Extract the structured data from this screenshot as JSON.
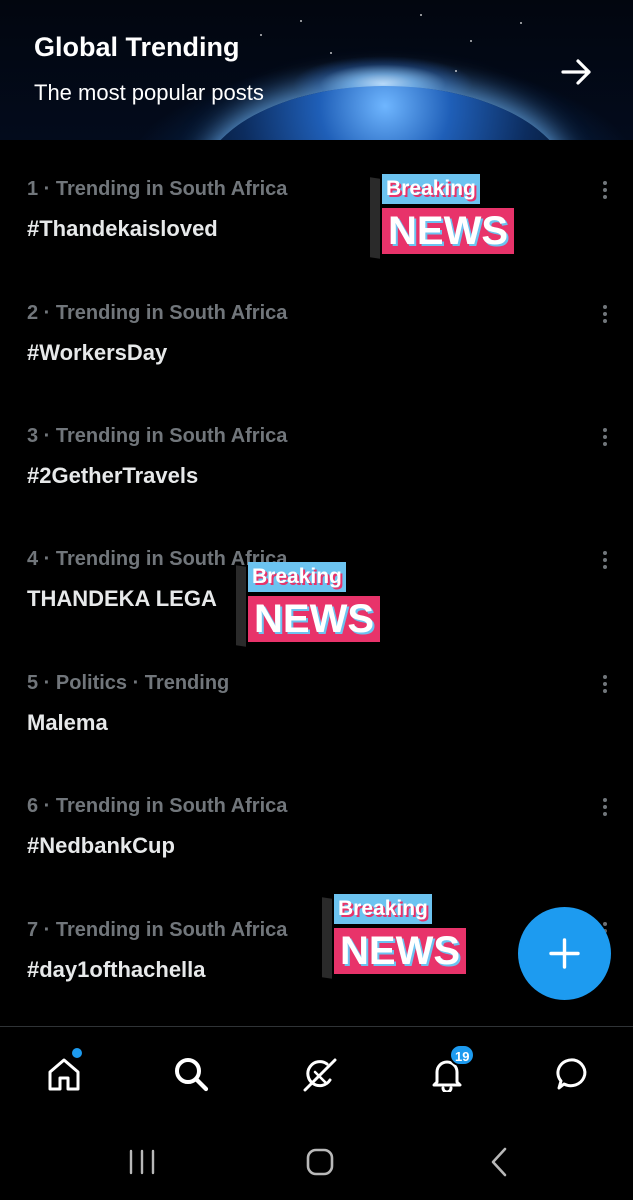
{
  "banner": {
    "title": "Global Trending",
    "subtitle": "The most popular posts",
    "arrow_icon": "arrow-right-icon"
  },
  "trends": [
    {
      "meta": "1 · Trending in South Africa",
      "name": "#Thandekaisloved"
    },
    {
      "meta": "2 · Trending in South Africa",
      "name": "#WorkersDay"
    },
    {
      "meta": "3 · Trending in South Africa",
      "name": "#2GetherTravels"
    },
    {
      "meta": "4 · Trending in South Africa",
      "name": "THANDEKA LEGA"
    },
    {
      "meta": "5 · Politics · Trending",
      "name": "Malema"
    },
    {
      "meta": "6 · Trending in South Africa",
      "name": "#NedbankCup"
    },
    {
      "meta": "7 · Trending in South Africa",
      "name": "#day1ofthachella"
    }
  ],
  "stickers": [
    {
      "top": "Breaking",
      "bottom": "NEWS"
    },
    {
      "top": "Breaking",
      "bottom": "NEWS"
    },
    {
      "top": "Breaking",
      "bottom": "NEWS"
    }
  ],
  "fab": {
    "icon": "plus-icon"
  },
  "bottom_nav": {
    "items": [
      "home-icon",
      "search-icon",
      "grok-icon",
      "bell-icon",
      "messages-icon"
    ],
    "notifications_count": "19"
  },
  "system_nav": [
    "recents-icon",
    "home-icon",
    "back-icon"
  ],
  "colors": {
    "accent": "#1d9bf0",
    "muted_text": "#71767b",
    "primary_text": "#e7e9ea",
    "background": "#000000",
    "sticker_pink": "#e8336a",
    "sticker_blue": "#6cc3f0"
  }
}
